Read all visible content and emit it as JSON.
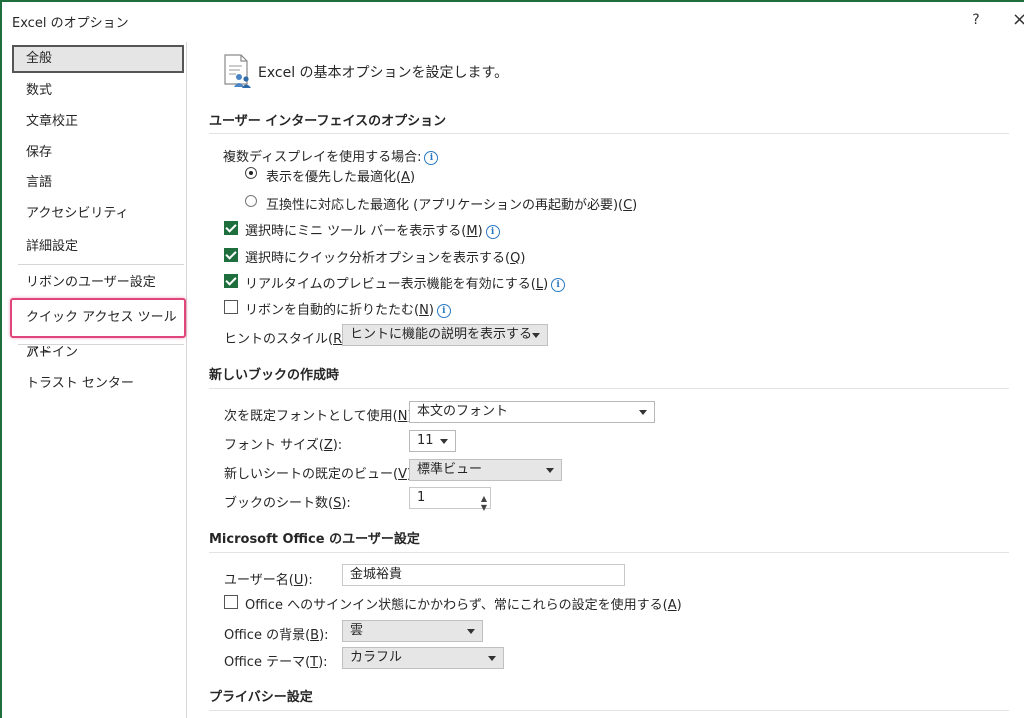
{
  "window": {
    "title": "Excel のオプション",
    "help": "?",
    "close": "×"
  },
  "sidebar": {
    "items": [
      {
        "label": "全般"
      },
      {
        "label": "数式"
      },
      {
        "label": "文章校正"
      },
      {
        "label": "保存"
      },
      {
        "label": "言語"
      },
      {
        "label": "アクセシビリティ"
      },
      {
        "label": "詳細設定"
      },
      {
        "label": "リボンのユーザー設定"
      },
      {
        "label": "クイック アクセス ツール バー"
      },
      {
        "label": "アドイン"
      },
      {
        "label": "トラスト センター"
      }
    ],
    "highlight_color": "#e0457b"
  },
  "header": {
    "text": "Excel の基本オプションを設定します。"
  },
  "ui_options": {
    "title": "ユーザー インターフェイスのオプション",
    "multi_display_label": "複数ディスプレイを使用する場合:",
    "radio_display": "表示を優先した最適化(",
    "radio_display_key": "A",
    "radio_compat": "互換性に対応した最適化 (アプリケーションの再起動が必要)(",
    "radio_compat_key": "C",
    "mini_toolbar": "選択時にミニ ツール バーを表示する(",
    "mini_toolbar_key": "M",
    "quick_analysis": "選択時にクイック分析オプションを表示する(",
    "quick_analysis_key": "Q",
    "live_preview": "リアルタイムのプレビュー表示機能を有効にする(",
    "live_preview_key": "L",
    "collapse_ribbon": "リボンを自動的に折りたたむ(",
    "collapse_ribbon_key": "N",
    "tooltip_label": "ヒントのスタイル(",
    "tooltip_key": "R",
    "tooltip_value": "ヒントに機能の説明を表示する"
  },
  "new_workbook": {
    "title": "新しいブックの作成時",
    "font_label": "次を既定フォントとして使用(",
    "font_key": "N",
    "font_value": "本文のフォント",
    "size_label": "フォント サイズ(",
    "size_key": "Z",
    "size_value": "11",
    "view_label": "新しいシートの既定のビュー(",
    "view_key": "V",
    "view_value": "標準ビュー",
    "sheets_label": "ブックのシート数(",
    "sheets_key": "S",
    "sheets_value": "1"
  },
  "office": {
    "title": "Microsoft Office のユーザー設定",
    "username_label": "ユーザー名(",
    "username_key": "U",
    "username_value": "金城裕貴",
    "always_use": "Office へのサインイン状態にかかわらず、常にこれらの設定を使用する(",
    "always_use_key": "A",
    "background_label": "Office の背景(",
    "background_key": "B",
    "background_value": "雲",
    "theme_label": "Office テーマ(",
    "theme_key": "T",
    "theme_value": "カラフル"
  },
  "privacy": {
    "title": "プライバシー設定"
  },
  "colors": {
    "accent": "#1e6e3e",
    "info": "#2b79c2"
  }
}
